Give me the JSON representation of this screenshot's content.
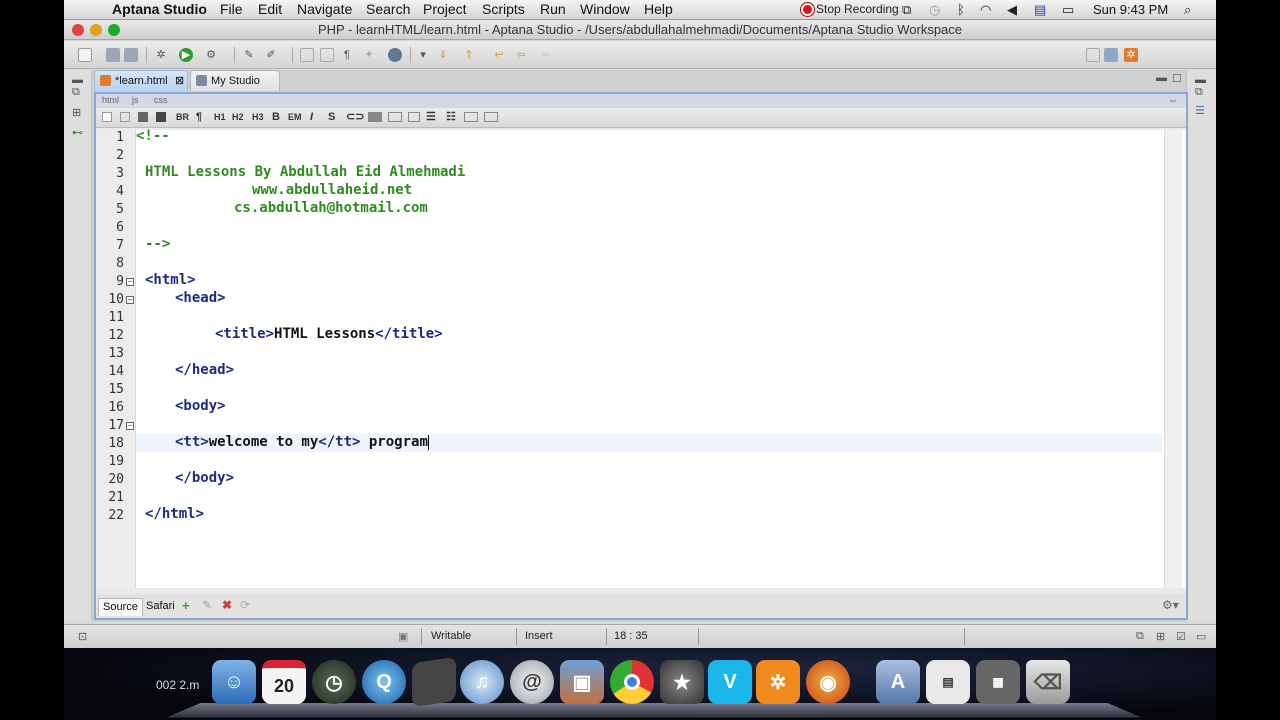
{
  "menubar": {
    "app": "Aptana Studio",
    "items": [
      "File",
      "Edit",
      "Navigate",
      "Search",
      "Project",
      "Scripts",
      "Run",
      "Window",
      "Help"
    ],
    "stop_recording": "Stop Recording",
    "clock": "Sun 9:43 PM"
  },
  "window": {
    "title": "PHP - learnHTML/learn.html - Aptana Studio - /Users/abdullahalmehmadi/Documents/Aptana Studio Workspace"
  },
  "tabs": [
    {
      "label": "*learn.html",
      "close": "⊠"
    },
    {
      "label": "My Studio"
    }
  ],
  "langs": [
    "html",
    "js",
    "css"
  ],
  "format_buttons": [
    "BR",
    "¶",
    "H1",
    "H2",
    "H3",
    "B",
    "EM",
    "I",
    "S"
  ],
  "code": {
    "line_numbers": [
      "1",
      "2",
      "3",
      "4",
      "5",
      "6",
      "7",
      "8",
      "9",
      "10",
      "11",
      "12",
      "13",
      "14",
      "15",
      "16",
      "17",
      "18",
      "19",
      "20",
      "21",
      "22"
    ],
    "lines": {
      "l1": "<!--",
      "l3": "HTML Lessons By Abdullah Eid Almehmadi",
      "l4": "www.abdullaheid.net",
      "l5": "cs.abdullah@hotmail.com",
      "l7": "-->",
      "l9": "<html>",
      "l10": "<head>",
      "l12_open": "<title>",
      "l12_text": "HTML Lessons",
      "l12_close": "</title>",
      "l14": "</head>",
      "l16": "<body>",
      "l18_open": "<tt>",
      "l18_text": "welcome to my",
      "l18_close": "</tt>",
      "l18_after": " program",
      "l20": "</body>",
      "l22": "</html>"
    }
  },
  "bottom_tabs": [
    "Source",
    "Safari"
  ],
  "status": {
    "mode": "Writable",
    "insert": "Insert",
    "position": "18 : 35"
  },
  "dock": {
    "label": "002 2.m",
    "calendar_day": "20"
  }
}
